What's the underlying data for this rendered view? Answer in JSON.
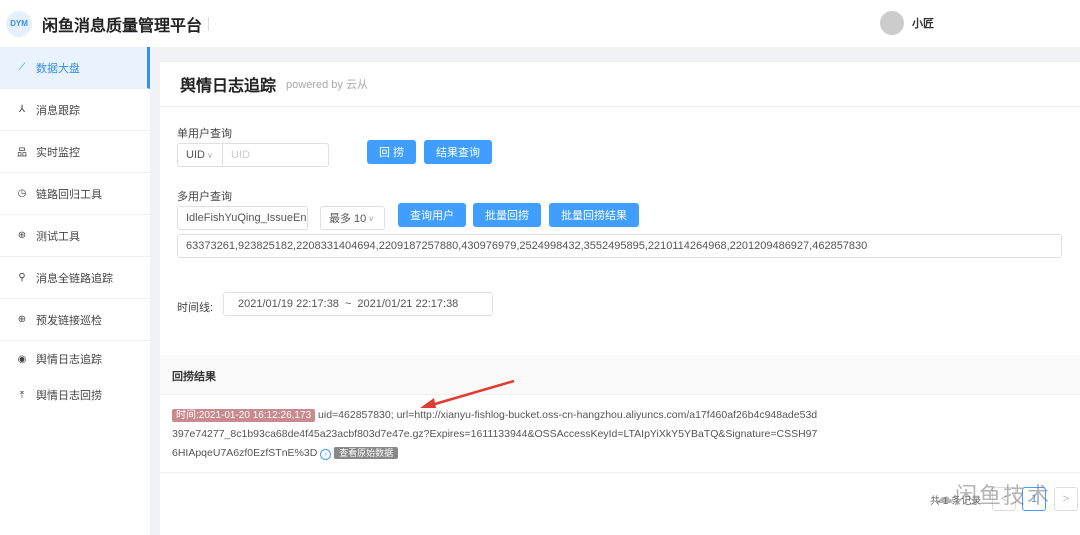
{
  "header": {
    "logo": "DYM",
    "title": "闲鱼消息质量管理平台",
    "user": "小匠"
  },
  "sidebar": {
    "items": [
      {
        "label": "数据大盘",
        "icon": "chart-icon"
      },
      {
        "label": "消息跟踪",
        "icon": "network-icon"
      },
      {
        "label": "实时监控",
        "icon": "sitemap-icon"
      },
      {
        "label": "链路回归工具",
        "icon": "history-icon"
      },
      {
        "label": "测试工具",
        "icon": "globe-icon"
      },
      {
        "label": "消息全链路追踪",
        "icon": "search-icon"
      },
      {
        "label": "预发链接巡检",
        "icon": "globe-icon"
      },
      {
        "label": "舆情日志追踪",
        "icon": "eye-icon"
      },
      {
        "label": "舆情日志回捞",
        "icon": "upload-icon"
      }
    ]
  },
  "page": {
    "title": "舆情日志追踪",
    "subtitle": "powered by 云从"
  },
  "single": {
    "label": "单用户查询",
    "select": "UID",
    "placeholder": "UID",
    "btn_fetch": "回 捞",
    "btn_result": "结果查询"
  },
  "multi": {
    "label": "多用户查询",
    "input": "IdleFishYuQing_IssueEn",
    "max": "最多 10",
    "btn_query": "查询用户",
    "btn_batch": "批量回捞",
    "btn_batch_result": "批量回捞结果",
    "uids": "63373261,923825182,2208331404694,2209187257880,430976979,2524998432,3552495895,2210114264968,2201209486927,462857830"
  },
  "timeline": {
    "label": "时间线:",
    "start": "2021/01/19 22:17:38",
    "sep": "~",
    "end": "2021/01/21 22:17:38"
  },
  "results": {
    "title": "回捞结果",
    "time_tag": "时间:2021-01-20 16:12:26,173",
    "text": "uid=462857830; url=http://xianyu-fishlog-bucket.oss-cn-hangzhou.aliyuncs.com/a17f460af26b4c948ade53d397e74277_8c1b93ca68de4f45a23acbf803d7e47e.gz?Expires=1611133944&OSSAccessKeyId=LTAIpYiXkY5YBaTQ&Signature=CSSH976HIApqeU7A6zf0EzfSTnE%3D",
    "view_btn": "查看原始数据"
  },
  "pagination": {
    "total": "共 1 条记录",
    "page": "1",
    "prev": "<",
    "next": ">"
  },
  "watermark": "闲鱼技术"
}
